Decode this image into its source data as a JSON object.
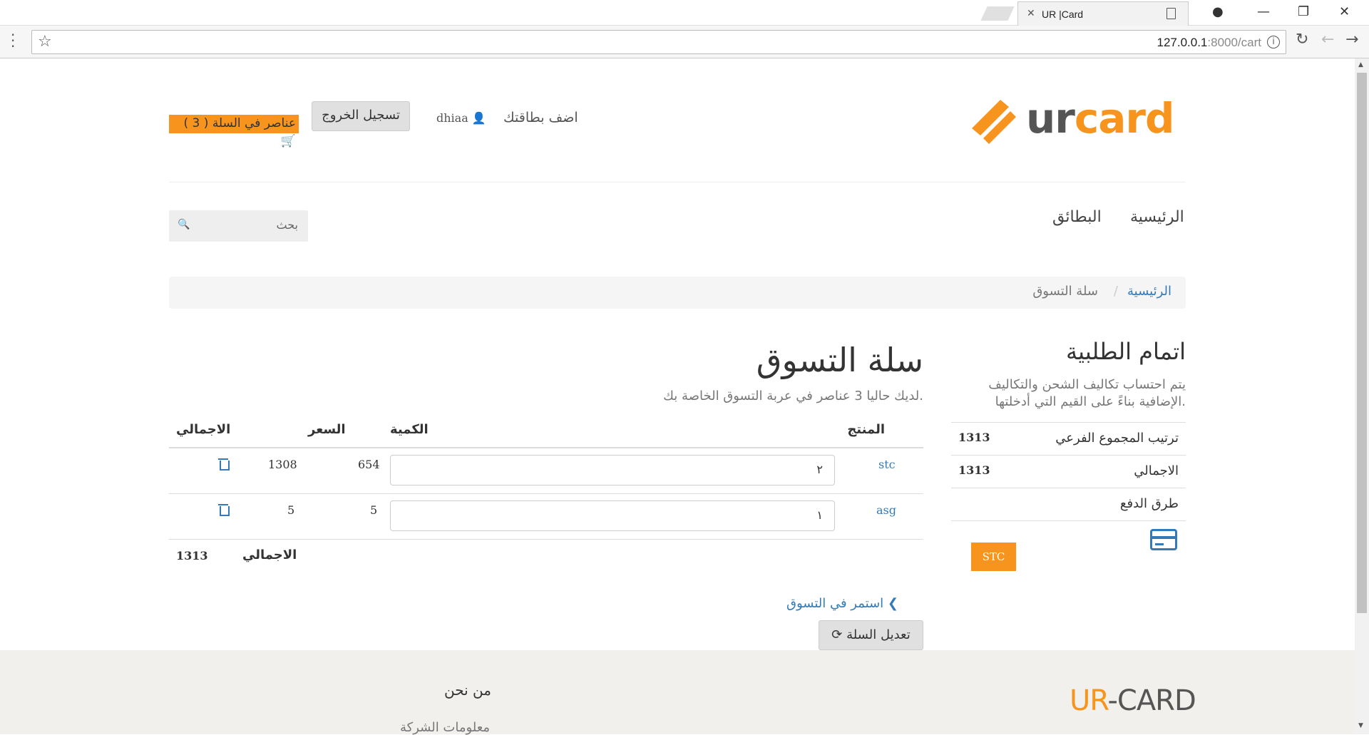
{
  "browser": {
    "tab_title": "UR |Card",
    "url_host": "127.0.0.1",
    "url_path": ":8000/cart"
  },
  "header": {
    "add_card": "اضف بطاقتك",
    "username": "dhiaa",
    "logout": "تسجيل الخروج",
    "cart_badge": "( 3 ) عناصر في السلة"
  },
  "nav": {
    "home": "الرئيسية",
    "cards": "البطائق",
    "search_placeholder": "بحث"
  },
  "breadcrumb": {
    "home": "الرئيسية",
    "separator": "/",
    "current": "سلة التسوق"
  },
  "checkout": {
    "title": "اتمام الطلبية",
    "description": "يتم احتساب تكاليف الشحن والتكاليف الإضافية بناءً على القيم التي أدخلتها.",
    "subtotal_label": "ترتيب المجموع الفرعي",
    "subtotal_value": "1313",
    "total_label": "الاجمالي",
    "total_value": "1313",
    "payment_label": "طرق الدفع",
    "payment_button": "STC"
  },
  "cart": {
    "title": "سلة التسوق",
    "subtitle": "لديك حاليا 3 عناصر في عربة التسوق الخاصة بك.",
    "columns": {
      "product": "المنتج",
      "quantity": "الكمية",
      "price": "السعر",
      "total": "الاجمالي"
    },
    "items": [
      {
        "name": "stc",
        "quantity": "٢",
        "price": "654",
        "total": "1308"
      },
      {
        "name": "asg",
        "quantity": "١",
        "price": "5",
        "total": "5"
      }
    ],
    "grand_total_label": "الاجمالي",
    "grand_total_value": "1313",
    "continue_shopping": "استمر في التسوق",
    "update_cart": "تعديل السلة"
  },
  "footer": {
    "logo_ur": "UR",
    "logo_dash": "-",
    "logo_card": "CARD",
    "about_title": "من نحن",
    "company_info": "معلومات الشركة"
  },
  "colors": {
    "accent": "#f7941d",
    "link": "#337ab7"
  }
}
